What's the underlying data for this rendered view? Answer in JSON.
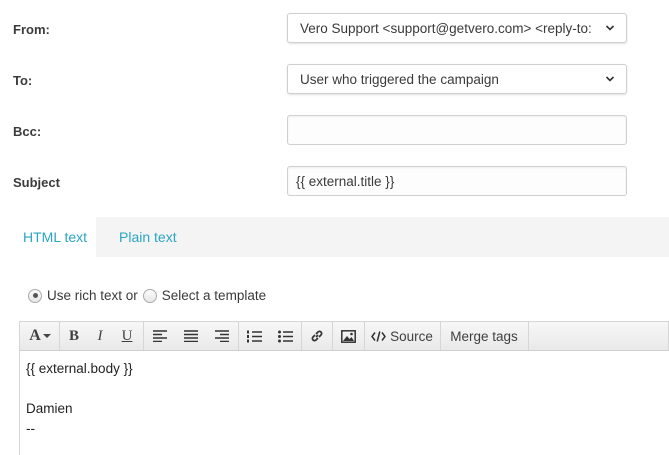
{
  "form": {
    "from": {
      "label": "From:",
      "value": "Vero Support <support@getvero.com> <reply-to: "
    },
    "to": {
      "label": "To:",
      "value": "User who triggered the campaign"
    },
    "bcc": {
      "label": "Bcc:",
      "value": ""
    },
    "subject": {
      "label": "Subject",
      "value": "{{ external.title }}"
    }
  },
  "tabs": [
    {
      "label": "HTML text",
      "active": true
    },
    {
      "label": "Plain text",
      "active": false
    }
  ],
  "mode": {
    "rich_text_label": "Use rich text or",
    "template_label": "Select a template",
    "selected": "rich_text"
  },
  "toolbar": {
    "font_label": "A",
    "bold": "B",
    "italic": "I",
    "underline": "U",
    "source_label": "Source",
    "merge_tags_label": "Merge tags"
  },
  "editor": {
    "lines": [
      "{{ external.body }}",
      "",
      "Damien",
      "--"
    ]
  },
  "colors": {
    "accent": "#2aa6c4"
  }
}
